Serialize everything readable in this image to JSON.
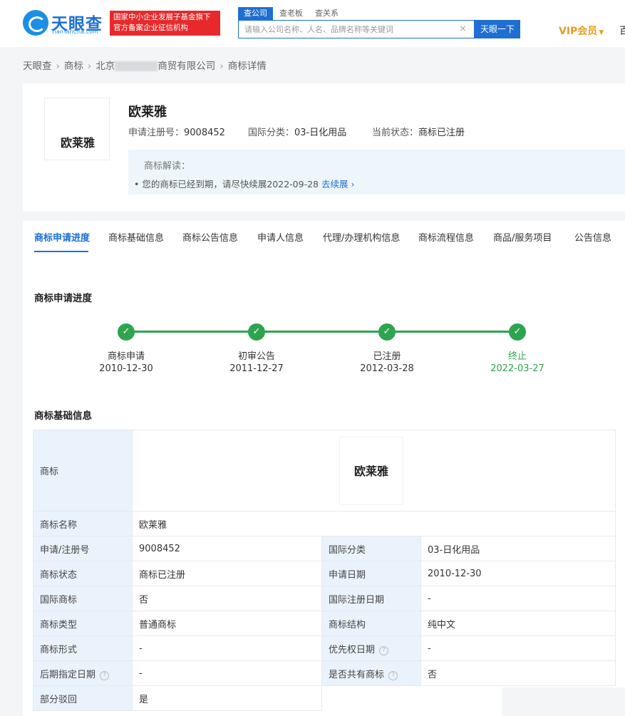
{
  "header": {
    "logo_text": "天眼查",
    "logo_domain": "TianYanCha.com",
    "badge_line1": "国家中小企业发展子基金旗下",
    "badge_line2": "官方备案企业征信机构",
    "search_tabs": [
      "查公司",
      "查老板",
      "查关系"
    ],
    "search_placeholder": "请输入公司名称、人名、品牌名称等关键词",
    "search_clear": "×",
    "search_button": "天眼一下",
    "vip_label": "VIP会员",
    "vip_caret": "▼",
    "cut_char": "百"
  },
  "breadcrumb": {
    "home": "天眼查",
    "trademark": "商标",
    "company_prefix": "北京",
    "company_suffix": "商贸有限公司",
    "current": "商标详情",
    "separator": "›"
  },
  "trademark": {
    "image_text": "欧莱雅",
    "name": "欧莱雅",
    "reg_no_label": "申请注册号：",
    "reg_no": "9008452",
    "intl_class_label": "国际分类：",
    "intl_class": "03-日化用品",
    "status_label": "当前状态：",
    "status": "商标已注册",
    "interp_title": "商标解读：",
    "interp_text": "• 您的商标已经到期，请尽快续展2022-09-28",
    "interp_link": "去续展 ›"
  },
  "tabs": [
    "商标申请进度",
    "商标基础信息",
    "商标公告信息",
    "申请人信息",
    "代理/办理机构信息",
    "商标流程信息",
    "商品/服务项目",
    "公告信息"
  ],
  "progress": {
    "title": "商标申请进度",
    "check": "✓",
    "steps": [
      {
        "label": "商标申请",
        "date": "2010-12-30"
      },
      {
        "label": "初审公告",
        "date": "2011-12-27"
      },
      {
        "label": "已注册",
        "date": "2012-03-28"
      },
      {
        "label": "终止",
        "date": "2022-03-27"
      }
    ]
  },
  "basic_info": {
    "title": "商标基础信息",
    "help_icon": "?",
    "image_label": "商标",
    "image_text": "欧莱雅",
    "name_label": "商标名称",
    "name_value": "欧莱雅",
    "rows": [
      {
        "k1": "申请/注册号",
        "v1": "9008452",
        "k2": "国际分类",
        "v2": "03-日化用品"
      },
      {
        "k1": "商标状态",
        "v1": "商标已注册",
        "k2": "申请日期",
        "v2": "2010-12-30"
      },
      {
        "k1": "国际商标",
        "v1": "否",
        "k2": "国际注册日期",
        "v2": "-"
      },
      {
        "k1": "商标类型",
        "v1": "普通商标",
        "k2": "商标结构",
        "v2": "纯中文"
      },
      {
        "k1": "商标形式",
        "v1": "-",
        "k2": "优先权日期",
        "v2": "-"
      },
      {
        "k1": "后期指定日期",
        "v1": "-",
        "k2": "是否共有商标",
        "v2": "否"
      }
    ],
    "last_label": "部分驳回",
    "last_value": "是"
  }
}
